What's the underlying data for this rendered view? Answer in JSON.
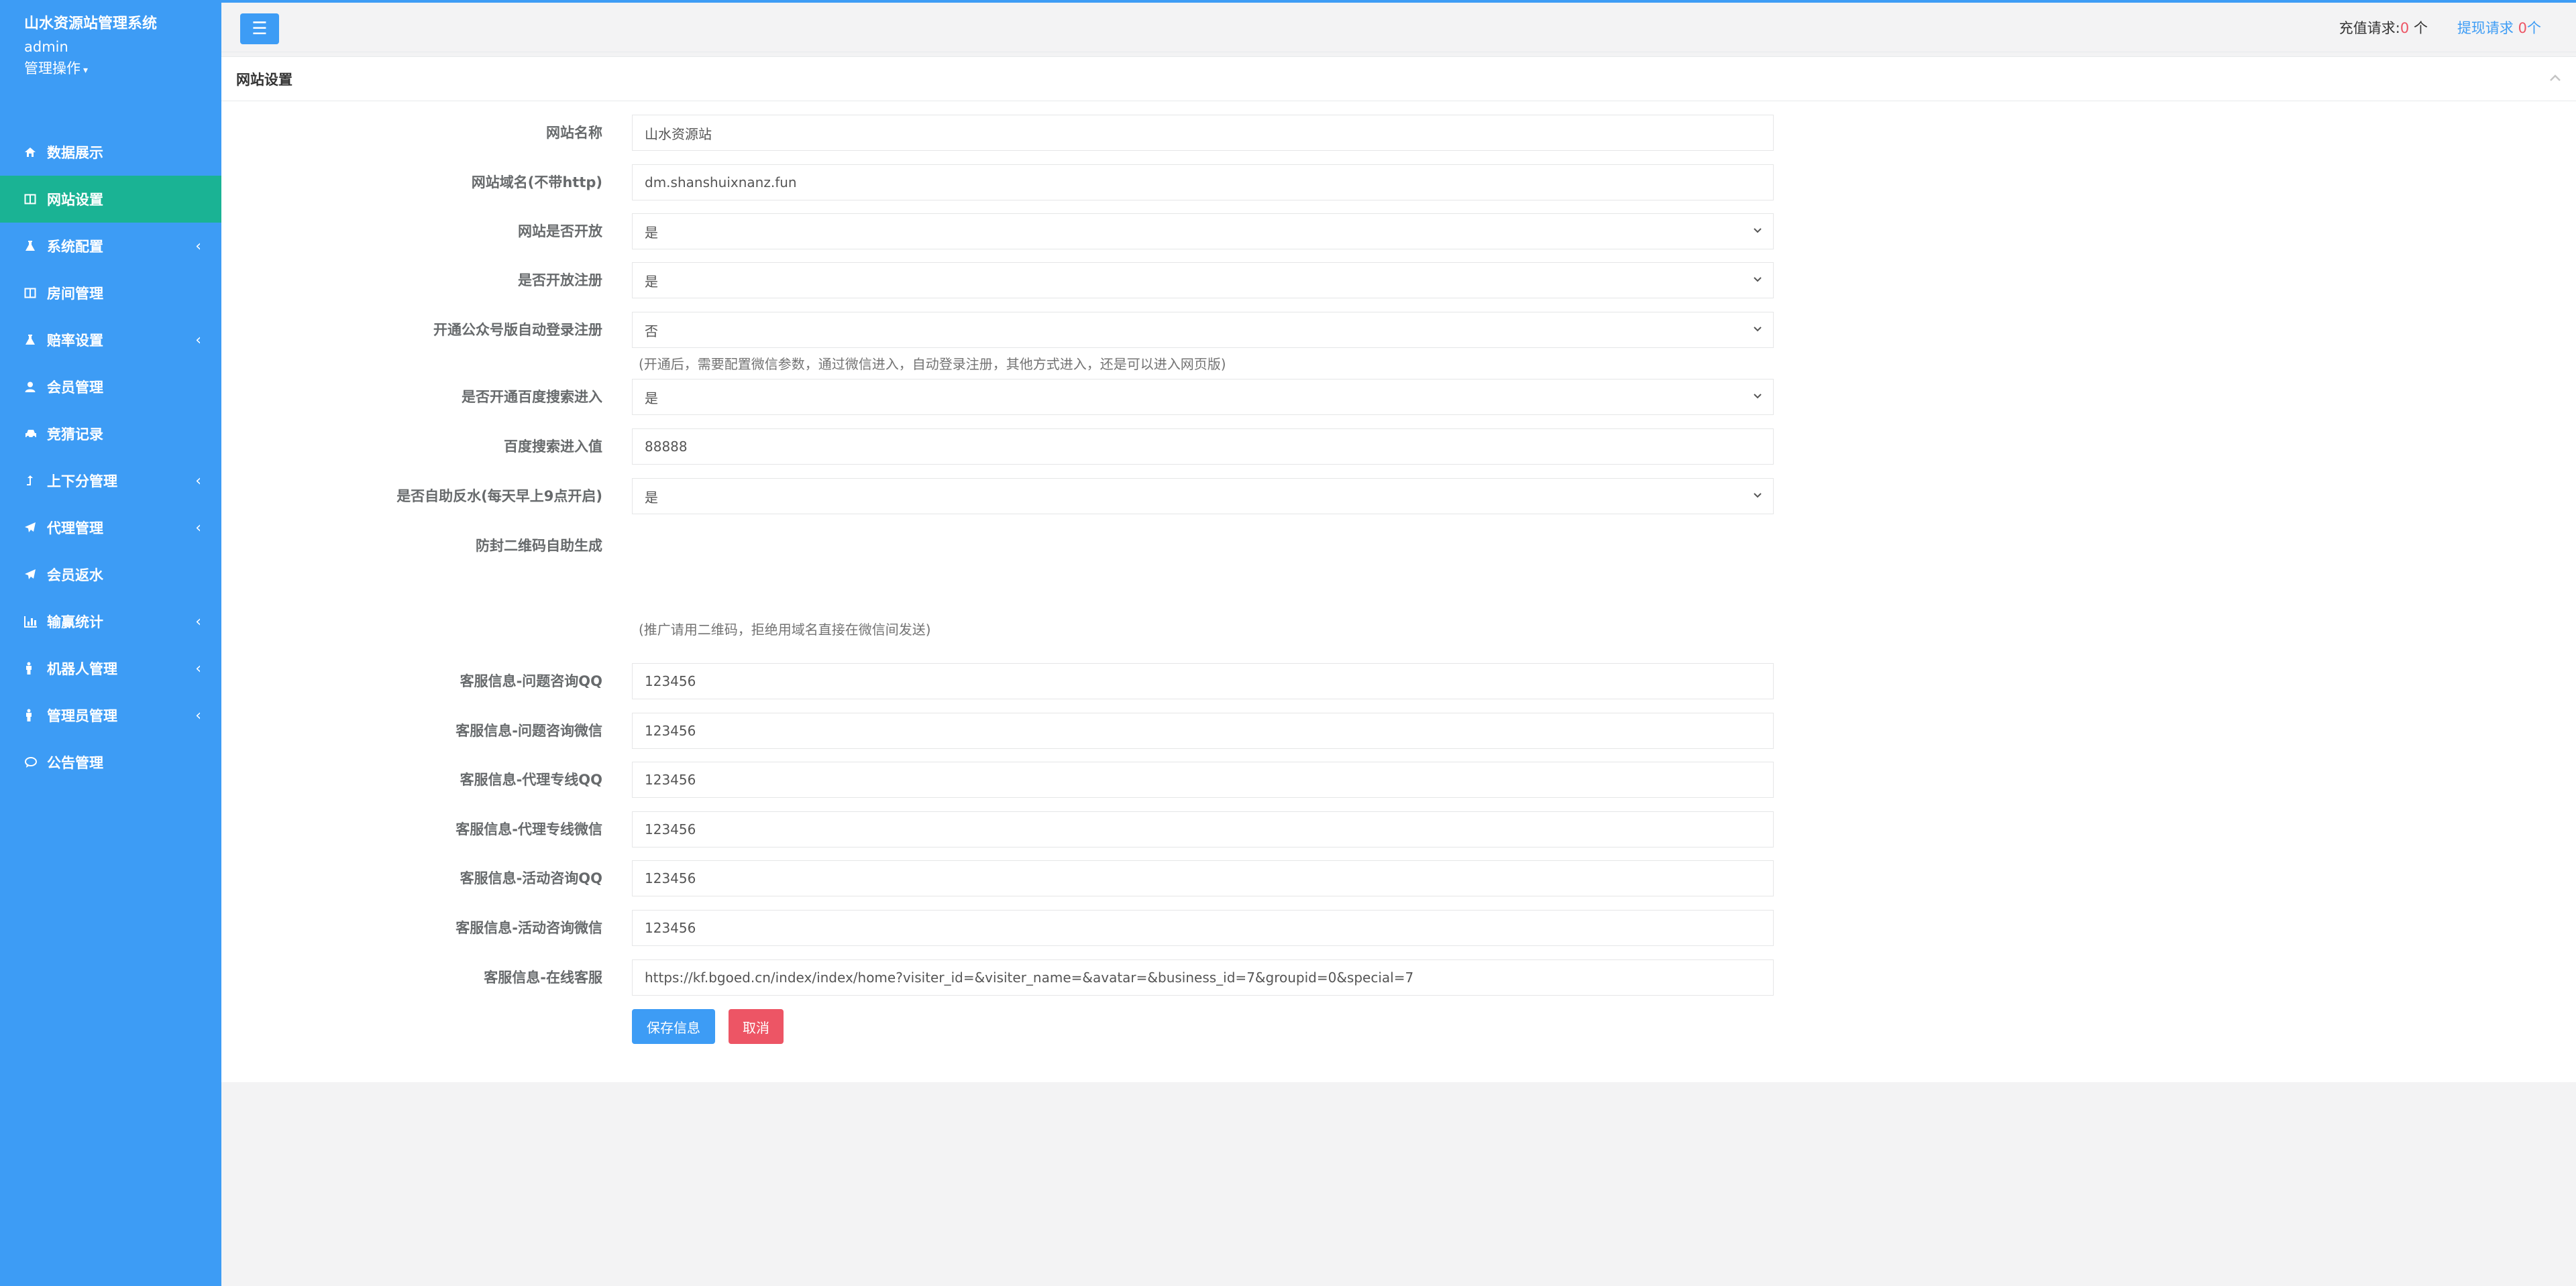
{
  "sidebar": {
    "title": "山水资源站管理系统",
    "user": "admin",
    "ops": "管理操作",
    "items": [
      {
        "label": "数据展示",
        "icon": "home-icon",
        "arrow": false,
        "active": false
      },
      {
        "label": "网站设置",
        "icon": "columns-icon",
        "arrow": false,
        "active": true
      },
      {
        "label": "系统配置",
        "icon": "flask-icon",
        "arrow": true,
        "active": false
      },
      {
        "label": "房间管理",
        "icon": "columns-icon",
        "arrow": false,
        "active": false
      },
      {
        "label": "赔率设置",
        "icon": "flask-icon",
        "arrow": true,
        "active": false
      },
      {
        "label": "会员管理",
        "icon": "user-icon",
        "arrow": false,
        "active": false
      },
      {
        "label": "竞猜记录",
        "icon": "car-icon",
        "arrow": false,
        "active": false
      },
      {
        "label": "上下分管理",
        "icon": "level-up-icon",
        "arrow": true,
        "active": false
      },
      {
        "label": "代理管理",
        "icon": "paper-plane-icon",
        "arrow": true,
        "active": false
      },
      {
        "label": "会员返水",
        "icon": "paper-plane-icon",
        "arrow": false,
        "active": false
      },
      {
        "label": "输赢统计",
        "icon": "bar-chart-icon",
        "arrow": true,
        "active": false
      },
      {
        "label": "机器人管理",
        "icon": "male-icon",
        "arrow": true,
        "active": false
      },
      {
        "label": "管理员管理",
        "icon": "male-icon",
        "arrow": true,
        "active": false
      },
      {
        "label": "公告管理",
        "icon": "comment-icon",
        "arrow": false,
        "active": false
      }
    ]
  },
  "topbar": {
    "recharge_label": "充值请求:",
    "recharge_count": "0",
    "recharge_unit": "个",
    "withdraw_label": "提现请求",
    "withdraw_count": "0",
    "withdraw_unit": "个"
  },
  "panel": {
    "title": "网站设置"
  },
  "form": {
    "site_name": {
      "label": "网站名称",
      "value": "山水资源站"
    },
    "site_domain": {
      "label": "网站域名(不带http)",
      "value": "dm.shanshuixnanz.fun"
    },
    "site_open": {
      "label": "网站是否开放",
      "value": "是"
    },
    "reg_open": {
      "label": "是否开放注册",
      "value": "是"
    },
    "wechat_login": {
      "label": "开通公众号版自动登录注册",
      "value": "否",
      "help": "(开通后，需要配置微信参数，通过微信进入，自动登录注册，其他方式进入，还是可以进入网页版)"
    },
    "baidu_enter": {
      "label": "是否开通百度搜索进入",
      "value": "是"
    },
    "baidu_value": {
      "label": "百度搜索进入值",
      "value": "88888"
    },
    "auto_rebate": {
      "label": "是否自助反水(每天早上9点开启)",
      "value": "是"
    },
    "qrcode": {
      "label": "防封二维码自助生成",
      "help": "(推广请用二维码，拒绝用域名直接在微信间发送)"
    },
    "cs_qq_question": {
      "label": "客服信息-问题咨询QQ",
      "value": "123456"
    },
    "cs_wx_question": {
      "label": "客服信息-问题咨询微信",
      "value": "123456"
    },
    "cs_qq_agent": {
      "label": "客服信息-代理专线QQ",
      "value": "123456"
    },
    "cs_wx_agent": {
      "label": "客服信息-代理专线微信",
      "value": "123456"
    },
    "cs_qq_activity": {
      "label": "客服信息-活动咨询QQ",
      "value": "123456"
    },
    "cs_wx_activity": {
      "label": "客服信息-活动咨询微信",
      "value": "123456"
    },
    "cs_online": {
      "label": "客服信息-在线客服",
      "value": "https://kf.bgoed.cn/index/index/home?visiter_id=&visiter_name=&avatar=&business_id=7&groupid=0&special=7"
    },
    "save_label": "保存信息",
    "cancel_label": "取消"
  },
  "colors": {
    "primary": "#3d9cf5",
    "active": "#1ab394",
    "danger": "#ed5565"
  }
}
